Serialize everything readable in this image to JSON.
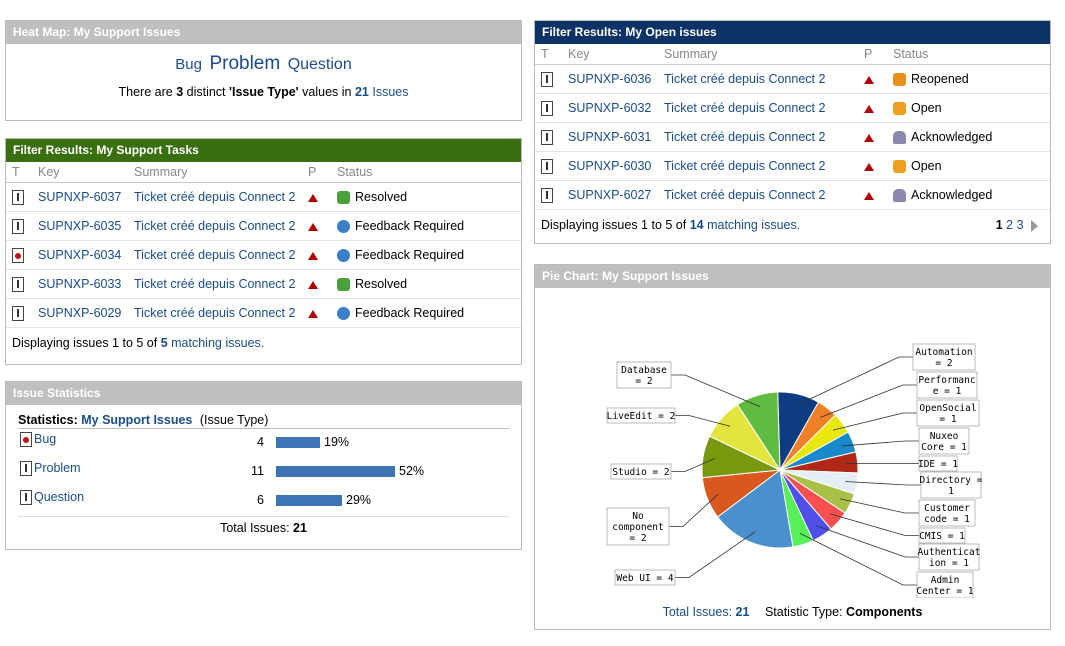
{
  "heatmap": {
    "title": "Heat Map: My Support Issues",
    "words": [
      "Bug",
      "Problem",
      "Question"
    ],
    "summary_pre": "There are",
    "distinct": "3",
    "summary_mid": "distinct",
    "field": "'Issue Type'",
    "summary_post": "values in",
    "count": "21",
    "issues_link": "Issues"
  },
  "tasks": {
    "title": "Filter Results: My Support Tasks",
    "columns": [
      "T",
      "Key",
      "Summary",
      "P",
      "Status"
    ],
    "rows": [
      {
        "type": "doc",
        "key": "SUPNXP-6037",
        "summary": "Ticket créé depuis Connect 2",
        "status": "Resolved",
        "status_icon": "resolved-icon"
      },
      {
        "type": "doc",
        "key": "SUPNXP-6035",
        "summary": "Ticket créé depuis Connect 2",
        "status": "Feedback Required",
        "status_icon": "feedback-icon"
      },
      {
        "type": "bug",
        "key": "SUPNXP-6034",
        "summary": "Ticket créé depuis Connect 2",
        "status": "Feedback Required",
        "status_icon": "feedback-icon"
      },
      {
        "type": "doc",
        "key": "SUPNXP-6033",
        "summary": "Ticket créé depuis Connect 2",
        "status": "Resolved",
        "status_icon": "resolved-icon"
      },
      {
        "type": "doc",
        "key": "SUPNXP-6029",
        "summary": "Ticket créé depuis Connect 2",
        "status": "Feedback Required",
        "status_icon": "feedback-icon"
      }
    ],
    "footer_pre": "Displaying issues 1 to 5 of",
    "footer_count": "5",
    "footer_link": "matching issues."
  },
  "stats": {
    "title": "Issue Statistics",
    "label": "Statistics:",
    "filter_link": "My Support Issues",
    "field": "(Issue Type)",
    "rows": [
      {
        "name": "Bug",
        "count": "4",
        "pct": "19%",
        "fraction": 0.19,
        "icon": "bug"
      },
      {
        "name": "Problem",
        "count": "11",
        "pct": "52%",
        "fraction": 0.52,
        "icon": "doc"
      },
      {
        "name": "Question",
        "count": "6",
        "pct": "29%",
        "fraction": 0.29,
        "icon": "doc"
      }
    ],
    "total_label": "Total Issues:",
    "total": "21"
  },
  "open": {
    "title": "Filter Results: My Open issues",
    "columns": [
      "T",
      "Key",
      "Summary",
      "P",
      "Status"
    ],
    "rows": [
      {
        "key": "SUPNXP-6036",
        "summary": "Ticket créé depuis Connect 2",
        "status": "Reopened",
        "status_icon": "reopened-icon"
      },
      {
        "key": "SUPNXP-6032",
        "summary": "Ticket créé depuis Connect 2",
        "status": "Open",
        "status_icon": "open-icon"
      },
      {
        "key": "SUPNXP-6031",
        "summary": "Ticket créé depuis Connect 2",
        "status": "Acknowledged",
        "status_icon": "acknowledged-icon"
      },
      {
        "key": "SUPNXP-6030",
        "summary": "Ticket créé depuis Connect 2",
        "status": "Open",
        "status_icon": "open-icon"
      },
      {
        "key": "SUPNXP-6027",
        "summary": "Ticket créé depuis Connect 2",
        "status": "Acknowledged",
        "status_icon": "acknowledged-icon"
      }
    ],
    "footer_pre": "Displaying issues 1 to 5 of",
    "footer_count": "14",
    "footer_link": "matching issues.",
    "pages": [
      "1",
      "2",
      "3"
    ],
    "current_page": "1"
  },
  "pie": {
    "title": "Pie Chart: My Support Issues",
    "total_label": "Total Issues:",
    "total": "21",
    "stat_label": "Statistic Type:",
    "stat_value": "Components"
  },
  "chart_data": {
    "type": "pie",
    "title": "",
    "slices": [
      {
        "label": "Automation = 2",
        "value": 2,
        "color": "#0d3d80"
      },
      {
        "label": "Performance = 1",
        "value": 1,
        "color": "#f08028"
      },
      {
        "label": "OpenSocial = 1",
        "value": 1,
        "color": "#e8e810"
      },
      {
        "label": "Nuxeo Core = 1",
        "value": 1,
        "color": "#1a88cc"
      },
      {
        "label": "IDE = 1",
        "value": 1,
        "color": "#b02818"
      },
      {
        "label": "Directory = 1",
        "value": 1,
        "color": "#e4eef4"
      },
      {
        "label": "Customer code = 1",
        "value": 1,
        "color": "#a8c048"
      },
      {
        "label": "CMIS = 1",
        "value": 1,
        "color": "#f85050"
      },
      {
        "label": "Authentication = 1",
        "value": 1,
        "color": "#5050e8"
      },
      {
        "label": "Admin Center = 1",
        "value": 1,
        "color": "#58f058"
      },
      {
        "label": "Web UI = 4",
        "value": 4,
        "color": "#4a90cc"
      },
      {
        "label": "No component = 2",
        "value": 2,
        "color": "#d85820"
      },
      {
        "label": "Studio = 2",
        "value": 2,
        "color": "#789810"
      },
      {
        "label": "LiveEdit = 2",
        "value": 2,
        "color": "#e4e440"
      },
      {
        "label": "Database = 2",
        "value": 2,
        "color": "#60bc40"
      }
    ],
    "label_text": [
      [
        "Automation",
        "= 2"
      ],
      [
        "Performanc",
        "e = 1"
      ],
      [
        "OpenSocial",
        "= 1"
      ],
      [
        "Nuxeo",
        "Core = 1"
      ],
      [
        "IDE = 1"
      ],
      [
        "Directory =",
        "1"
      ],
      [
        "Customer",
        "code = 1"
      ],
      [
        "CMIS = 1"
      ],
      [
        "Authenticat",
        "ion = 1"
      ],
      [
        "Admin",
        "Center = 1"
      ],
      [
        "Web UI = 4"
      ],
      [
        "No",
        "component",
        "= 2"
      ],
      [
        "Studio = 2"
      ],
      [
        "LiveEdit = 2"
      ],
      [
        "Database",
        "= 2"
      ]
    ]
  }
}
